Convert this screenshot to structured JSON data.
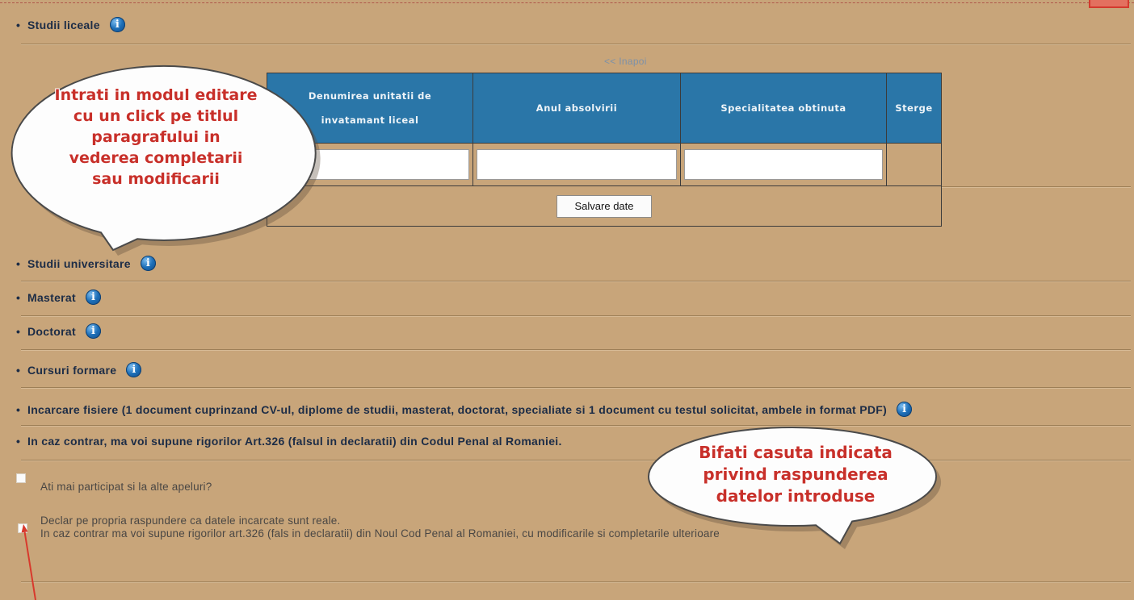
{
  "colors": {
    "page_bg": "#c8a57a",
    "table_header_bg": "#2a76a8",
    "info_icon": "#1d6fb8",
    "heading_text": "#1c2c46",
    "callout_text": "#c8302a",
    "arrow": "#d8392c"
  },
  "sections": [
    {
      "label": "Studii liceale",
      "icon": "info-icon"
    },
    {
      "label": "Studii universitare",
      "icon": "info-icon"
    },
    {
      "label": "Masterat",
      "icon": "info-icon"
    },
    {
      "label": "Doctorat",
      "icon": "info-icon"
    },
    {
      "label": "Cursuri formare",
      "icon": "info-icon"
    },
    {
      "label": "Incarcare fisiere (1 document cuprinzand CV-ul, diplome de studii, masterat, doctorat, specialiate si 1 document cu testul solicitat, ambele in format PDF)",
      "icon": "info-icon"
    },
    {
      "label": "In caz contrar, ma voi supune rigorilor Art.326 (falsul in declaratii) din Codul Penal al Romaniei."
    }
  ],
  "liceale_form": {
    "back_link": "<< Inapoi",
    "headers": [
      "Denumirea unitatii de invatamant liceal",
      "Anul absolvirii",
      "Specialitatea obtinuta",
      "Sterge"
    ],
    "row_values": [
      "",
      "",
      ""
    ],
    "save_button": "Salvare date"
  },
  "checkboxes": [
    {
      "checked": false,
      "label_lines": [
        "Ati mai participat si la alte apeluri?"
      ]
    },
    {
      "checked": false,
      "label_lines": [
        "Declar pe propria raspundere ca datele incarcate sunt reale.",
        "In caz contrar ma voi supune rigorilor art.326 (fals in declaratii) din Noul Cod Penal al Romaniei, cu modificarile si completarile ulterioare"
      ]
    }
  ],
  "callouts": [
    {
      "lines": [
        "Intrati in modul editare",
        "cu un click pe titlul",
        "paragrafului in",
        "vederea completarii",
        "sau modificarii"
      ]
    },
    {
      "lines": [
        "Bifati casuta indicata",
        "privind raspunderea",
        "datelor introduse"
      ]
    }
  ]
}
